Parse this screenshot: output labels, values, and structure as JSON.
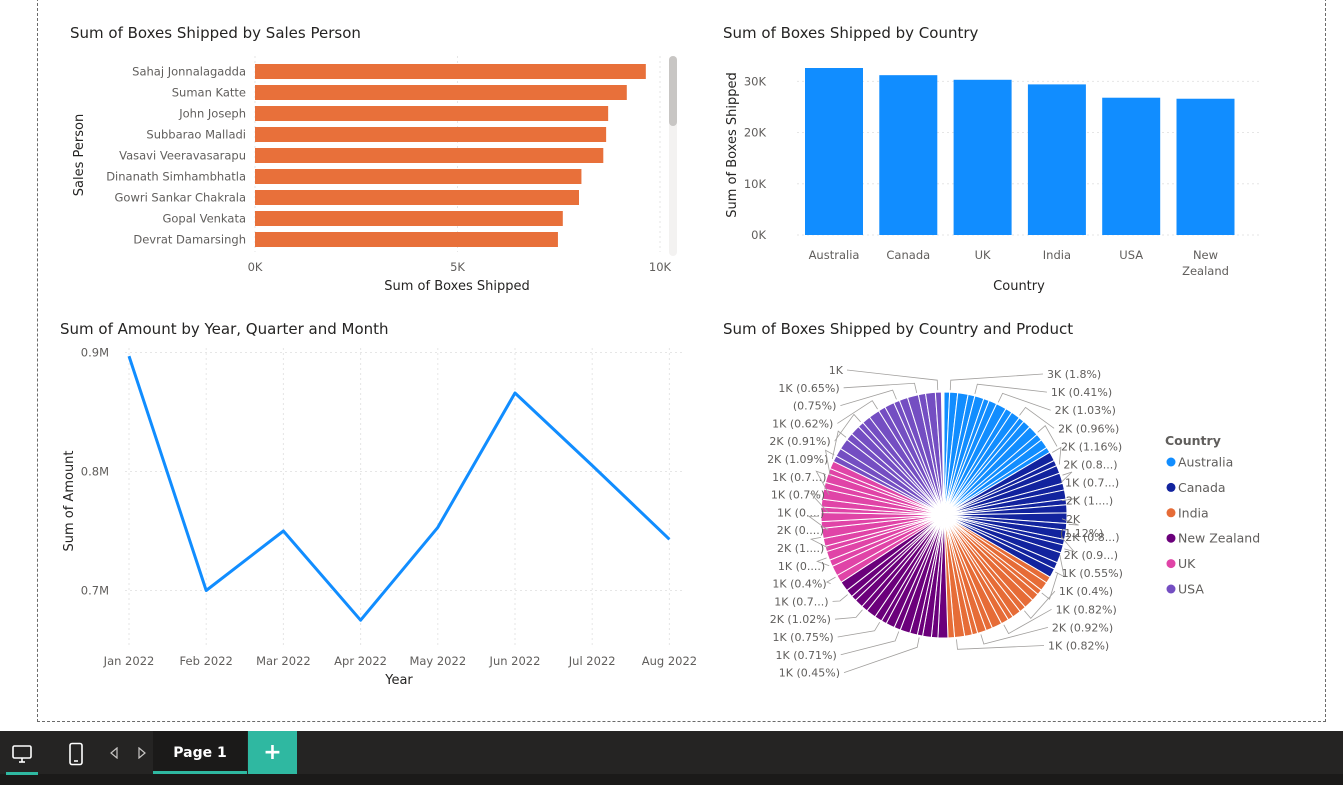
{
  "chart_data": [
    {
      "type": "bar",
      "orientation": "horizontal",
      "title": "Sum of Boxes Shipped by Sales Person",
      "xlabel": "Sum of Boxes Shipped",
      "ylabel": "Sales Person",
      "categories": [
        "Sahaj Jonnalagadda",
        "Suman Katte",
        "John Joseph",
        "Subbarao Malladi",
        "Vasavi Veeravasarapu",
        "Dinanath Simhambhatla",
        "Gowri Sankar Chakrala",
        "Gopal Venkata",
        "Devrat Damarsingh"
      ],
      "values": [
        9650,
        9180,
        8720,
        8670,
        8600,
        8060,
        8000,
        7600,
        7480
      ],
      "xlim": [
        0,
        10000
      ],
      "xticks": [
        "0K",
        "5K",
        "10K"
      ],
      "color": "#e8703a"
    },
    {
      "type": "bar",
      "title": "Sum of Boxes Shipped by Country",
      "xlabel": "Country",
      "ylabel": "Sum of Boxes Shipped",
      "categories": [
        "Australia",
        "Canada",
        "UK",
        "India",
        "USA",
        "New Zealand"
      ],
      "values": [
        32600,
        31200,
        30300,
        29400,
        26800,
        26600
      ],
      "ylim": [
        0,
        32600
      ],
      "yticks": [
        "0K",
        "10K",
        "20K",
        "30K"
      ],
      "color": "#118dff"
    },
    {
      "type": "line",
      "title": "Sum of Amount by Year, Quarter and Month",
      "xlabel": "Year",
      "ylabel": "Sum of Amount",
      "categories": [
        "Jan 2022",
        "Feb 2022",
        "Mar 2022",
        "Apr 2022",
        "May 2022",
        "Jun 2022",
        "Jul 2022",
        "Aug 2022"
      ],
      "values": [
        0.897,
        0.7,
        0.75,
        0.675,
        0.753,
        0.866,
        0.805,
        0.743
      ],
      "unit": "M",
      "ylim": [
        0.66,
        0.9
      ],
      "yticks": [
        "0.7M",
        "0.8M",
        "0.9M"
      ],
      "color": "#118dff"
    },
    {
      "type": "pie",
      "title": "Sum of Boxes Shipped by Country and Product",
      "legend_title": "Country",
      "legend": [
        {
          "name": "Australia",
          "color": "#118dff"
        },
        {
          "name": "Canada",
          "color": "#12239e"
        },
        {
          "name": "India",
          "color": "#e66c37"
        },
        {
          "name": "New Zealand",
          "color": "#6b007b"
        },
        {
          "name": "UK",
          "color": "#e044a7"
        },
        {
          "name": "USA",
          "color": "#744ec2"
        }
      ],
      "legend_position": "right",
      "slices_per_country": [
        16,
        16,
        16,
        16,
        16,
        16
      ],
      "country_shares": [
        0.168,
        0.168,
        0.162,
        0.16,
        0.164,
        0.178
      ],
      "labels_right": [
        "3K (1.8%)",
        "1K (0.41%)",
        "2K (1.03%)",
        "2K (0.96%)",
        "2K (1.16%)",
        "2K (0.8...)",
        "1K (0.7...)",
        "2K (1....)",
        "2K\n(1.12%)",
        "2K (0.8...)",
        "2K (0.9...)",
        "1K (0.55%)",
        "1K (0.4%)",
        "1K (0.82%)",
        "2K (0.92%)",
        "1K (0.82%)"
      ],
      "labels_left": [
        "1K",
        "1K (0.65%)",
        "(0.75%)",
        "1K (0.62%)",
        "2K (0.91%)",
        "2K (1.09%)",
        "1K (0.7...)",
        "1K (0.7%)",
        "1K (0....)",
        "2K (0....)",
        "2K (1....)",
        "1K (0....)",
        "1K (0.4%)",
        "1K (0.7...)",
        "2K (1.02%)",
        "1K (0.75%)",
        "1K (0.71%)",
        "1K (0.45%)"
      ]
    }
  ],
  "taskbar": {
    "page_tab": "Page 1",
    "add_page": "+",
    "icons": [
      "desktop-view-icon",
      "mobile-view-icon",
      "prev-page-icon",
      "next-page-icon"
    ]
  }
}
